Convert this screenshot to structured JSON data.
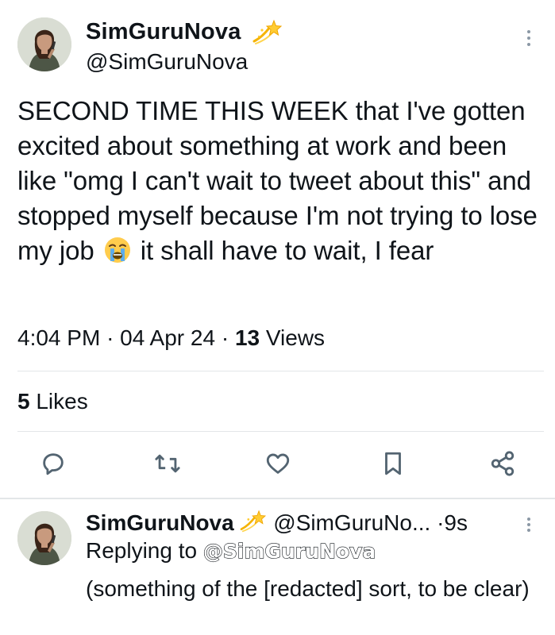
{
  "tweet": {
    "author_name": "SimGuruNova",
    "author_handle": "@SimGuruNova",
    "name_emoji": "sparkle-star-emoji",
    "text_before_emoji": "SECOND TIME THIS WEEK that I've gotten excited about something at work and been like \"omg I can't wait to tweet about this\" and stopped myself because I'm not trying to lose my job",
    "emoji": "loudly-crying-face-emoji",
    "text_after_emoji": "it shall have to wait, I fear",
    "time": "4:04 PM",
    "separator": "·",
    "date": "04 Apr 24",
    "views_count": "13",
    "views_label": "Views",
    "likes_count": "5",
    "likes_label": "Likes"
  },
  "actions": {
    "reply": "reply-icon",
    "retweet": "retweet-icon",
    "like": "heart-icon",
    "bookmark": "bookmark-icon",
    "share": "share-icon"
  },
  "reply": {
    "author_name": "SimGuruNova",
    "author_handle": "@SimGuruNo...",
    "separator": "·",
    "time": "9s",
    "replying_prefix": "Replying to",
    "replying_to": "@SimGuruNova",
    "text": "(something of the [redacted] sort, to be clear)"
  },
  "colors": {
    "text": "#0f1419",
    "icon": "#536471",
    "divider": "#e3e6e8"
  }
}
